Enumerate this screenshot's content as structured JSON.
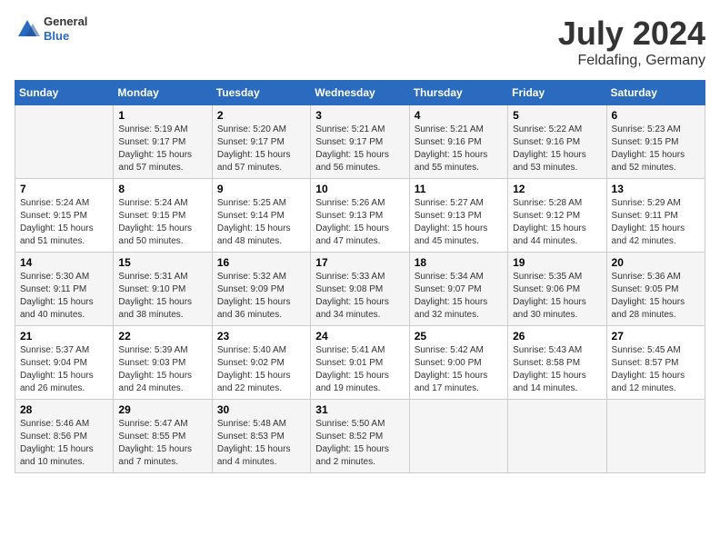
{
  "header": {
    "logo": {
      "general": "General",
      "blue": "Blue"
    },
    "title": "July 2024",
    "subtitle": "Feldafing, Germany"
  },
  "weekdays": [
    "Sunday",
    "Monday",
    "Tuesday",
    "Wednesday",
    "Thursday",
    "Friday",
    "Saturday"
  ],
  "weeks": [
    [
      {
        "day": "",
        "sunrise": "",
        "sunset": "",
        "daylight": ""
      },
      {
        "day": "1",
        "sunrise": "Sunrise: 5:19 AM",
        "sunset": "Sunset: 9:17 PM",
        "daylight": "Daylight: 15 hours and 57 minutes."
      },
      {
        "day": "2",
        "sunrise": "Sunrise: 5:20 AM",
        "sunset": "Sunset: 9:17 PM",
        "daylight": "Daylight: 15 hours and 57 minutes."
      },
      {
        "day": "3",
        "sunrise": "Sunrise: 5:21 AM",
        "sunset": "Sunset: 9:17 PM",
        "daylight": "Daylight: 15 hours and 56 minutes."
      },
      {
        "day": "4",
        "sunrise": "Sunrise: 5:21 AM",
        "sunset": "Sunset: 9:16 PM",
        "daylight": "Daylight: 15 hours and 55 minutes."
      },
      {
        "day": "5",
        "sunrise": "Sunrise: 5:22 AM",
        "sunset": "Sunset: 9:16 PM",
        "daylight": "Daylight: 15 hours and 53 minutes."
      },
      {
        "day": "6",
        "sunrise": "Sunrise: 5:23 AM",
        "sunset": "Sunset: 9:15 PM",
        "daylight": "Daylight: 15 hours and 52 minutes."
      }
    ],
    [
      {
        "day": "7",
        "sunrise": "Sunrise: 5:24 AM",
        "sunset": "Sunset: 9:15 PM",
        "daylight": "Daylight: 15 hours and 51 minutes."
      },
      {
        "day": "8",
        "sunrise": "Sunrise: 5:24 AM",
        "sunset": "Sunset: 9:15 PM",
        "daylight": "Daylight: 15 hours and 50 minutes."
      },
      {
        "day": "9",
        "sunrise": "Sunrise: 5:25 AM",
        "sunset": "Sunset: 9:14 PM",
        "daylight": "Daylight: 15 hours and 48 minutes."
      },
      {
        "day": "10",
        "sunrise": "Sunrise: 5:26 AM",
        "sunset": "Sunset: 9:13 PM",
        "daylight": "Daylight: 15 hours and 47 minutes."
      },
      {
        "day": "11",
        "sunrise": "Sunrise: 5:27 AM",
        "sunset": "Sunset: 9:13 PM",
        "daylight": "Daylight: 15 hours and 45 minutes."
      },
      {
        "day": "12",
        "sunrise": "Sunrise: 5:28 AM",
        "sunset": "Sunset: 9:12 PM",
        "daylight": "Daylight: 15 hours and 44 minutes."
      },
      {
        "day": "13",
        "sunrise": "Sunrise: 5:29 AM",
        "sunset": "Sunset: 9:11 PM",
        "daylight": "Daylight: 15 hours and 42 minutes."
      }
    ],
    [
      {
        "day": "14",
        "sunrise": "Sunrise: 5:30 AM",
        "sunset": "Sunset: 9:11 PM",
        "daylight": "Daylight: 15 hours and 40 minutes."
      },
      {
        "day": "15",
        "sunrise": "Sunrise: 5:31 AM",
        "sunset": "Sunset: 9:10 PM",
        "daylight": "Daylight: 15 hours and 38 minutes."
      },
      {
        "day": "16",
        "sunrise": "Sunrise: 5:32 AM",
        "sunset": "Sunset: 9:09 PM",
        "daylight": "Daylight: 15 hours and 36 minutes."
      },
      {
        "day": "17",
        "sunrise": "Sunrise: 5:33 AM",
        "sunset": "Sunset: 9:08 PM",
        "daylight": "Daylight: 15 hours and 34 minutes."
      },
      {
        "day": "18",
        "sunrise": "Sunrise: 5:34 AM",
        "sunset": "Sunset: 9:07 PM",
        "daylight": "Daylight: 15 hours and 32 minutes."
      },
      {
        "day": "19",
        "sunrise": "Sunrise: 5:35 AM",
        "sunset": "Sunset: 9:06 PM",
        "daylight": "Daylight: 15 hours and 30 minutes."
      },
      {
        "day": "20",
        "sunrise": "Sunrise: 5:36 AM",
        "sunset": "Sunset: 9:05 PM",
        "daylight": "Daylight: 15 hours and 28 minutes."
      }
    ],
    [
      {
        "day": "21",
        "sunrise": "Sunrise: 5:37 AM",
        "sunset": "Sunset: 9:04 PM",
        "daylight": "Daylight: 15 hours and 26 minutes."
      },
      {
        "day": "22",
        "sunrise": "Sunrise: 5:39 AM",
        "sunset": "Sunset: 9:03 PM",
        "daylight": "Daylight: 15 hours and 24 minutes."
      },
      {
        "day": "23",
        "sunrise": "Sunrise: 5:40 AM",
        "sunset": "Sunset: 9:02 PM",
        "daylight": "Daylight: 15 hours and 22 minutes."
      },
      {
        "day": "24",
        "sunrise": "Sunrise: 5:41 AM",
        "sunset": "Sunset: 9:01 PM",
        "daylight": "Daylight: 15 hours and 19 minutes."
      },
      {
        "day": "25",
        "sunrise": "Sunrise: 5:42 AM",
        "sunset": "Sunset: 9:00 PM",
        "daylight": "Daylight: 15 hours and 17 minutes."
      },
      {
        "day": "26",
        "sunrise": "Sunrise: 5:43 AM",
        "sunset": "Sunset: 8:58 PM",
        "daylight": "Daylight: 15 hours and 14 minutes."
      },
      {
        "day": "27",
        "sunrise": "Sunrise: 5:45 AM",
        "sunset": "Sunset: 8:57 PM",
        "daylight": "Daylight: 15 hours and 12 minutes."
      }
    ],
    [
      {
        "day": "28",
        "sunrise": "Sunrise: 5:46 AM",
        "sunset": "Sunset: 8:56 PM",
        "daylight": "Daylight: 15 hours and 10 minutes."
      },
      {
        "day": "29",
        "sunrise": "Sunrise: 5:47 AM",
        "sunset": "Sunset: 8:55 PM",
        "daylight": "Daylight: 15 hours and 7 minutes."
      },
      {
        "day": "30",
        "sunrise": "Sunrise: 5:48 AM",
        "sunset": "Sunset: 8:53 PM",
        "daylight": "Daylight: 15 hours and 4 minutes."
      },
      {
        "day": "31",
        "sunrise": "Sunrise: 5:50 AM",
        "sunset": "Sunset: 8:52 PM",
        "daylight": "Daylight: 15 hours and 2 minutes."
      },
      {
        "day": "",
        "sunrise": "",
        "sunset": "",
        "daylight": ""
      },
      {
        "day": "",
        "sunrise": "",
        "sunset": "",
        "daylight": ""
      },
      {
        "day": "",
        "sunrise": "",
        "sunset": "",
        "daylight": ""
      }
    ]
  ]
}
